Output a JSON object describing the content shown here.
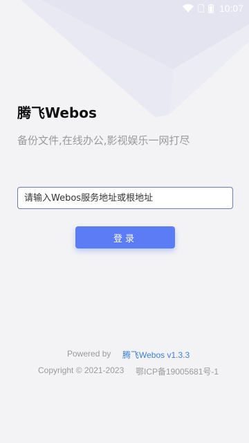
{
  "status_bar": {
    "time": "10:07",
    "icons": [
      "wifi-icon",
      "sim-icon",
      "battery-icon"
    ]
  },
  "app": {
    "title": "腾飞Webos",
    "subtitle": "备份文件,在线办公,影视娱乐一网打尽"
  },
  "login_form": {
    "server_input_placeholder": "请输入Webos服务地址或根地址",
    "server_input_value": "",
    "login_label": "登录"
  },
  "footer": {
    "powered_by": "Powered by",
    "version_link": "腾飞Webos v1.3.3",
    "copyright": "Copyright © 2021-2023",
    "icp": "鄂ICP备19005681号-1"
  },
  "colors": {
    "background": "#f3f3f5",
    "primary": "#5b7cf5",
    "link": "#3d7fd6",
    "muted_text": "#9a9a9a",
    "title_text": "#111111",
    "input_border": "#6b7bb0"
  }
}
